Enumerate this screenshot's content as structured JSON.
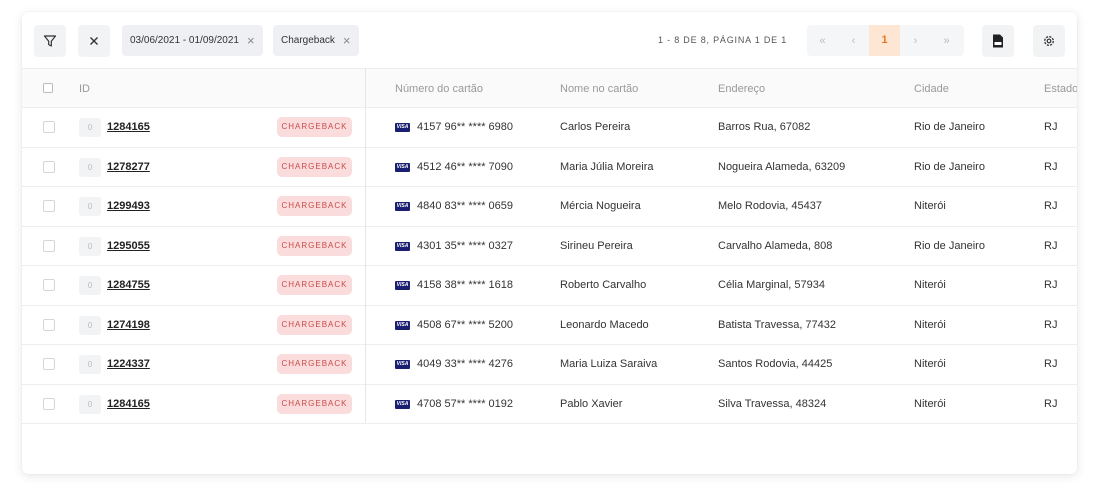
{
  "toolbar": {
    "filter_icon": "filter-icon",
    "clear_icon": "close-icon",
    "chips": [
      {
        "label": "03/06/2021 - 01/09/2021"
      },
      {
        "label": "Chargeback"
      }
    ],
    "pagination_info": "1 - 8 DE 8, PÁGINA 1 DE 1",
    "pager": {
      "first": "«",
      "prev": "‹",
      "current": "1",
      "next": "›",
      "last": "»"
    },
    "csv_icon": "csv-file-icon",
    "settings_icon": "gear-icon"
  },
  "table": {
    "headers": {
      "id": "ID",
      "card_number": "Número do cartão",
      "card_name": "Nome no cartão",
      "address": "Endereço",
      "city": "Cidade",
      "state": "Estado"
    },
    "rows": [
      {
        "count": "0",
        "id": "1284165",
        "status": "CHARGEBACK",
        "card": "4157 96** **** 6980",
        "name": "Carlos Pereira",
        "address": "Barros Rua, 67082",
        "city": "Rio de Janeiro",
        "state": "RJ"
      },
      {
        "count": "0",
        "id": "1278277",
        "status": "CHARGEBACK",
        "card": "4512 46** **** 7090",
        "name": "Maria Júlia Moreira",
        "address": "Nogueira Alameda, 63209",
        "city": "Rio de Janeiro",
        "state": "RJ"
      },
      {
        "count": "0",
        "id": "1299493",
        "status": "CHARGEBACK",
        "card": "4840 83** **** 0659",
        "name": "Mércia Nogueira",
        "address": "Melo Rodovia, 45437",
        "city": "Niterói",
        "state": "RJ"
      },
      {
        "count": "0",
        "id": "1295055",
        "status": "CHARGEBACK",
        "card": "4301 35** **** 0327",
        "name": "Sirineu Pereira",
        "address": "Carvalho Alameda, 808",
        "city": "Rio de Janeiro",
        "state": "RJ"
      },
      {
        "count": "0",
        "id": "1284755",
        "status": "CHARGEBACK",
        "card": "4158 38** **** 1618",
        "name": "Roberto Carvalho",
        "address": "Célia Marginal, 57934",
        "city": "Niterói",
        "state": "RJ"
      },
      {
        "count": "0",
        "id": "1274198",
        "status": "CHARGEBACK",
        "card": "4508 67** **** 5200",
        "name": "Leonardo Macedo",
        "address": "Batista Travessa, 77432",
        "city": "Niterói",
        "state": "RJ"
      },
      {
        "count": "0",
        "id": "1224337",
        "status": "CHARGEBACK",
        "card": "4049 33** **** 4276",
        "name": "Maria Luiza Saraiva",
        "address": "Santos Rodovia, 44425",
        "city": "Niterói",
        "state": "RJ"
      },
      {
        "count": "0",
        "id": "1284165",
        "status": "CHARGEBACK",
        "card": "4708 57** **** 0192",
        "name": "Pablo Xavier",
        "address": "Silva Travessa, 48324",
        "city": "Niterói",
        "state": "RJ"
      }
    ],
    "card_brand": "VISA"
  },
  "colors": {
    "accent": "#e87722",
    "badge_bg": "#fbdcdc",
    "badge_text": "#c94b4b",
    "visa": "#1a1f71"
  }
}
